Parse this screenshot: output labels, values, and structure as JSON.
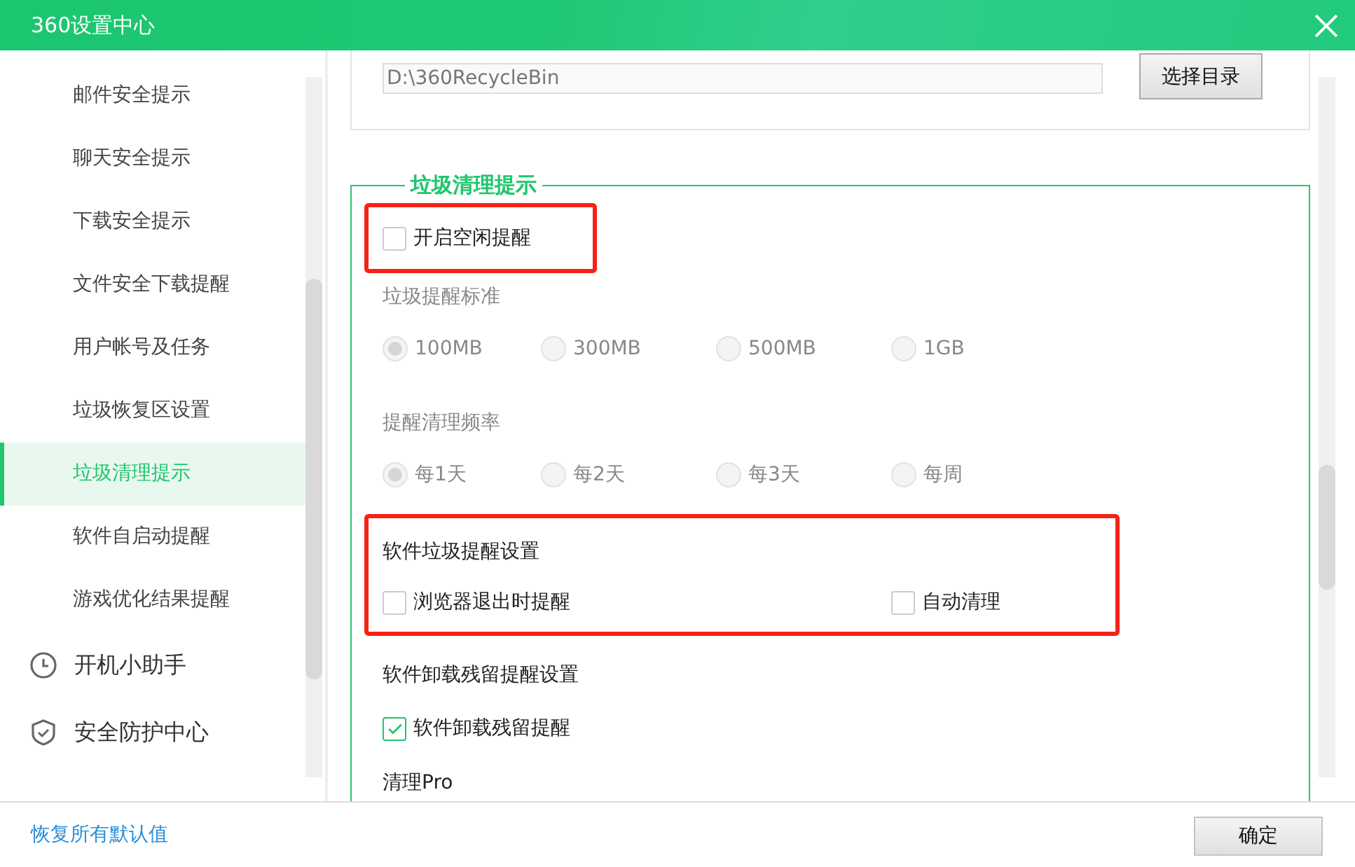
{
  "window": {
    "title": "360设置中心"
  },
  "sidebar": {
    "items": [
      {
        "label": "邮件安全提示",
        "selected": false
      },
      {
        "label": "聊天安全提示",
        "selected": false
      },
      {
        "label": "下载安全提示",
        "selected": false
      },
      {
        "label": "文件安全下载提醒",
        "selected": false
      },
      {
        "label": "用户帐号及任务",
        "selected": false
      },
      {
        "label": "垃圾恢复区设置",
        "selected": false
      },
      {
        "label": "垃圾清理提示",
        "selected": true
      },
      {
        "label": "软件自启动提醒",
        "selected": false
      },
      {
        "label": "游戏优化结果提醒",
        "selected": false
      }
    ],
    "groups": [
      {
        "label": "开机小助手"
      },
      {
        "label": "安全防护中心"
      }
    ]
  },
  "recycle_path": {
    "value": "D:\\360RecycleBin",
    "button": "选择目录"
  },
  "section": {
    "title": "垃圾清理提示",
    "items": [
      {
        "kind": "checks",
        "highlighted": true,
        "checks": [
          {
            "label": "开启空闲提醒",
            "checked": false
          }
        ]
      },
      {
        "kind": "heading",
        "label": "垃圾提醒标准",
        "disabled": true
      },
      {
        "kind": "radios",
        "disabled": true,
        "options": [
          {
            "label": "100MB",
            "selected": true
          },
          {
            "label": "300MB",
            "selected": false
          },
          {
            "label": "500MB",
            "selected": false
          },
          {
            "label": "1GB",
            "selected": false
          }
        ]
      },
      {
        "kind": "heading",
        "label": "提醒清理频率",
        "disabled": true
      },
      {
        "kind": "radios",
        "disabled": true,
        "options": [
          {
            "label": "每1天",
            "selected": true
          },
          {
            "label": "每2天",
            "selected": false
          },
          {
            "label": "每3天",
            "selected": false
          },
          {
            "label": "每周",
            "selected": false
          }
        ]
      },
      {
        "kind": "group",
        "highlighted": true,
        "label": "软件垃圾提醒设置",
        "checks": [
          {
            "label": "浏览器退出时提醒",
            "checked": false
          },
          {
            "label": "自动清理",
            "checked": false
          }
        ]
      },
      {
        "kind": "heading",
        "label": "软件卸载残留提醒设置",
        "disabled": false
      },
      {
        "kind": "checks",
        "highlighted": false,
        "checks": [
          {
            "label": "软件卸载残留提醒",
            "checked": true
          }
        ]
      },
      {
        "kind": "heading",
        "label": "清理Pro",
        "disabled": false
      }
    ]
  },
  "footer": {
    "link": "恢复所有默认值",
    "button": "确定"
  }
}
